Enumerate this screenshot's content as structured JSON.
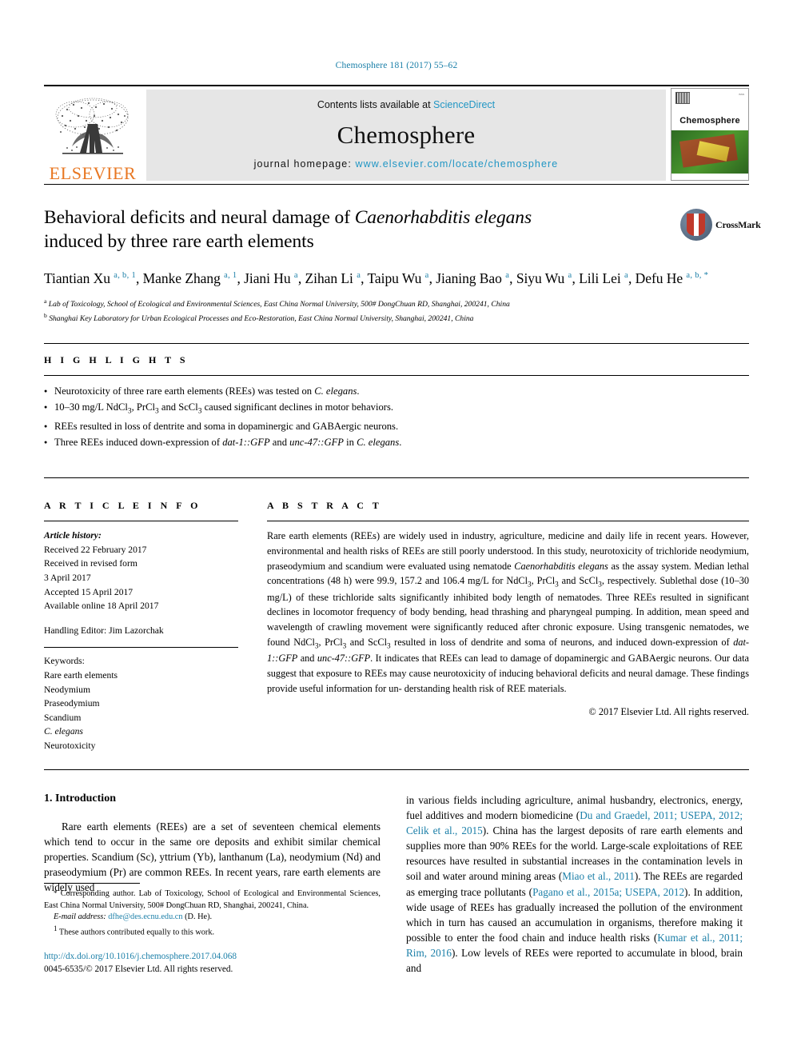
{
  "running_head": "Chemosphere 181 (2017) 55–62",
  "masthead": {
    "publisher_logo_text": "ELSEVIER",
    "contents_prefix": "Contents lists available at ",
    "contents_link": "ScienceDirect",
    "journal_name": "Chemosphere",
    "homepage_prefix": "journal homepage: ",
    "homepage_url": "www.elsevier.com/locate/chemosphere",
    "cover_title": "Chemosphere",
    "link_color": "#2196c4"
  },
  "article": {
    "title_line1_a": "Behavioral deficits and neural damage of ",
    "title_line1_italic": "Caenorhabditis elegans",
    "title_line2": "induced by three rare earth elements",
    "crossmark_label": "CrossMark",
    "authors": [
      {
        "name": "Tiantian Xu",
        "marks": "a, b, 1",
        "sep": ", "
      },
      {
        "name": "Manke Zhang",
        "marks": "a, 1",
        "sep": ", "
      },
      {
        "name": "Jiani Hu",
        "marks": "a",
        "sep": ", "
      },
      {
        "name": "Zihan Li",
        "marks": "a",
        "sep": ", "
      },
      {
        "name": "Taipu Wu",
        "marks": "a",
        "sep": ", "
      },
      {
        "name": "Jianing Bao",
        "marks": "a",
        "sep": ", "
      },
      {
        "name": "Siyu Wu",
        "marks": "a",
        "sep": ", "
      },
      {
        "name": "Lili Lei",
        "marks": "a",
        "sep": ", "
      },
      {
        "name": "Defu He",
        "marks": "a, b, *",
        "sep": ""
      }
    ],
    "affiliations": [
      {
        "mark": "a",
        "text": "Lab of Toxicology, School of Ecological and Environmental Sciences, East China Normal University, 500# DongChuan RD, Shanghai, 200241, China"
      },
      {
        "mark": "b",
        "text": "Shanghai Key Laboratory for Urban Ecological Processes and Eco-Restoration, East China Normal University, Shanghai, 200241, China"
      }
    ]
  },
  "highlights": {
    "label": "H I G H L I G H T S",
    "items": [
      "Neurotoxicity of three rare earth elements (REEs) was tested on C. elegans.",
      "10–30 mg/L NdCl3, PrCl3 and ScCl3 caused significant declines in motor behaviors.",
      "REEs resulted in loss of dentrite and soma in dopaminergic and GABAergic neurons.",
      "Three REEs induced down-expression of dat-1::GFP and unc-47::GFP in C. elegans."
    ]
  },
  "article_info": {
    "label": "A R T I C L E  I N F O",
    "history_label": "Article history:",
    "history": [
      "Received 22 February 2017",
      "Received in revised form",
      "3 April 2017",
      "Accepted 15 April 2017",
      "Available online 18 April 2017"
    ],
    "handling_editor": "Handling Editor: Jim Lazorchak",
    "keywords_label": "Keywords:",
    "keywords": [
      "Rare earth elements",
      "Neodymium",
      "Praseodymium",
      "Scandium",
      "C. elegans",
      "Neurotoxicity"
    ]
  },
  "abstract": {
    "label": "A B S T R A C T",
    "copyright": "© 2017 Elsevier Ltd. All rights reserved."
  },
  "introduction": {
    "heading": "1. Introduction"
  },
  "footnotes": {
    "corresponding_star": "*",
    "corresponding_text": "Corresponding author. Lab of Toxicology, School of Ecological and Environmental Sciences, East China Normal University, 500# DongChuan RD, Shanghai, 200241, China.",
    "email_label": "E-mail address:",
    "email": "dfhe@des.ecnu.edu.cn",
    "email_suffix": "(D. He).",
    "equal_mark": "1",
    "equal_text": "These authors contributed equally to this work.",
    "doi": "http://dx.doi.org/10.1016/j.chemosphere.2017.04.068",
    "issn": "0045-6535/© 2017 Elsevier Ltd. All rights reserved."
  },
  "colors": {
    "link": "#1b7fa8",
    "elsevier_orange": "#e87722",
    "masthead_bg": "#e6e6e6"
  }
}
